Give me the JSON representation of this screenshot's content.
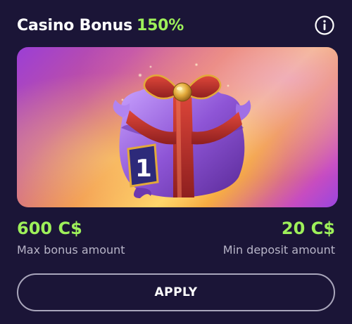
{
  "header": {
    "title": "Casino Bonus",
    "percent": "150%"
  },
  "banner": {
    "badge_number": "1"
  },
  "stats": {
    "max_bonus_value": "600 C$",
    "max_bonus_label": "Max bonus amount",
    "min_deposit_value": "20 C$",
    "min_deposit_label": "Min deposit amount"
  },
  "actions": {
    "apply_label": "APPLY"
  },
  "colors": {
    "background": "#1b1537",
    "accent": "#9ef05a",
    "muted_text": "#b8b5c8"
  },
  "icons": {
    "info": "info-icon",
    "gift": "gift-box-image"
  }
}
